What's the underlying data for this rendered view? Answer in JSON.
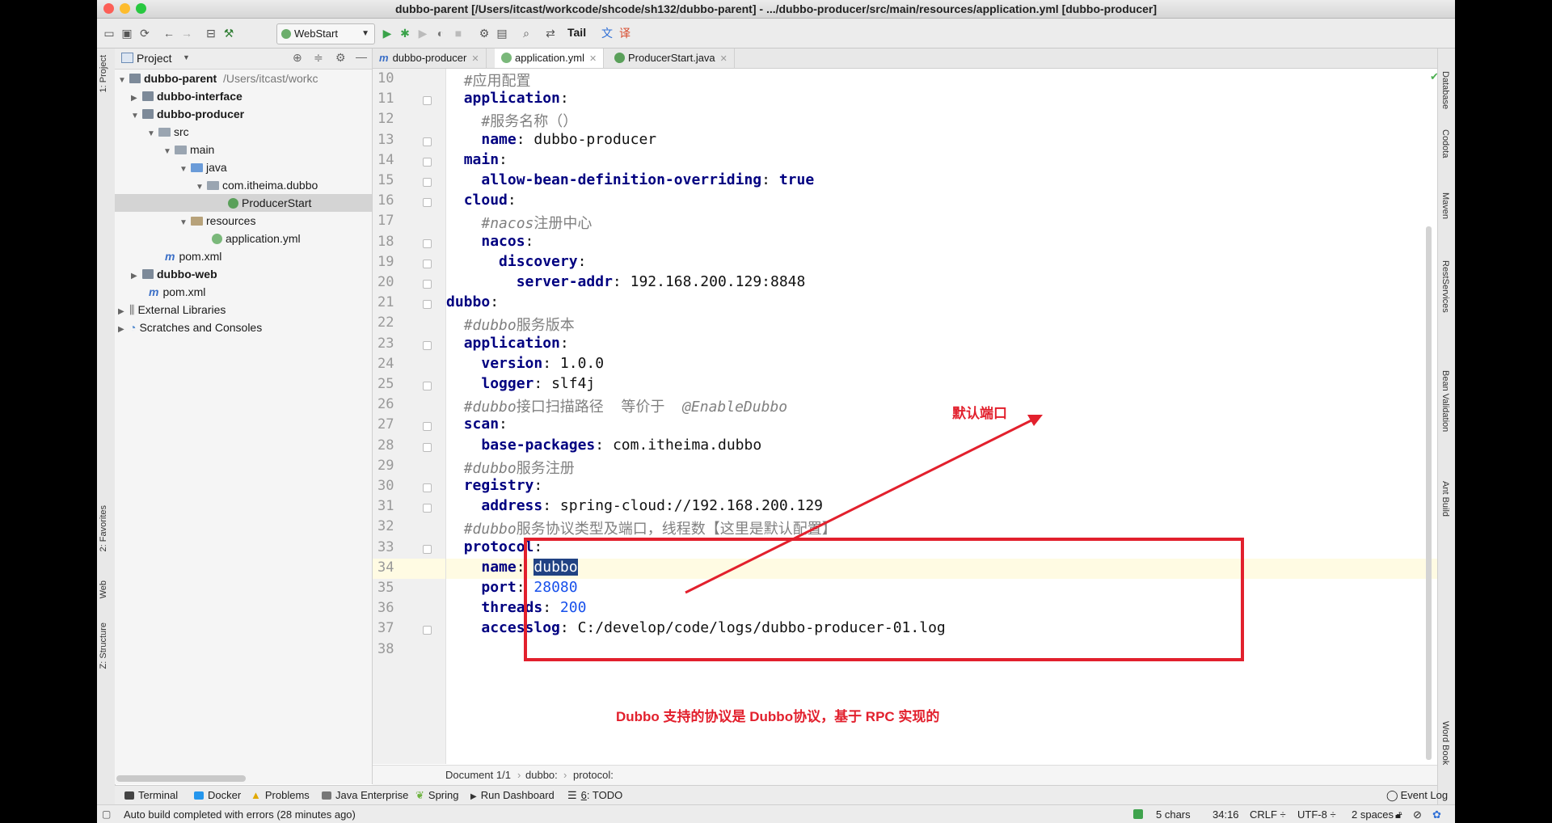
{
  "window": {
    "title": "dubbo-parent [/Users/itcast/workcode/shcode/sh132/dubbo-parent] - .../dubbo-producer/src/main/resources/application.yml [dubbo-producer]"
  },
  "toolbar": {
    "run_config": "WebStart",
    "tail_label": "Tail",
    "icons": [
      "open-folder-icon",
      "save-icon",
      "sync-icon",
      "back-arrow-icon",
      "forward-arrow-icon",
      "structure-icon",
      "hammer-icon",
      "run-icon",
      "debug-icon",
      "coverage-icon",
      "profile-icon",
      "stop-icon",
      "wrench-icon",
      "search-icon",
      "project-structure-icon",
      "translate-icon",
      "translate-red-icon"
    ]
  },
  "left_stripe": {
    "project": "1: Project",
    "favorites": "2: Favorites",
    "web": "Web",
    "structure": "Z: Structure"
  },
  "project_panel": {
    "header": "Project",
    "tree": [
      {
        "label": "dubbo-parent",
        "suffix": "/Users/itcast/workc",
        "bold": true
      },
      {
        "label": "dubbo-interface",
        "bold": true
      },
      {
        "label": "dubbo-producer",
        "bold": true
      },
      {
        "label": "src"
      },
      {
        "label": "main"
      },
      {
        "label": "java"
      },
      {
        "label": "com.itheima.dubbo"
      },
      {
        "label": "ProducerStart"
      },
      {
        "label": "resources"
      },
      {
        "label": "application.yml"
      },
      {
        "label": "pom.xml"
      },
      {
        "label": "dubbo-web",
        "bold": true
      },
      {
        "label": "pom.xml"
      },
      {
        "label": "External Libraries"
      },
      {
        "label": "Scratches and Consoles"
      }
    ]
  },
  "tabs": [
    {
      "label": "dubbo-producer"
    },
    {
      "label": "application.yml"
    },
    {
      "label": "ProducerStart.java"
    }
  ],
  "editor": {
    "line_numbers": [
      "10",
      "11",
      "12",
      "13",
      "14",
      "15",
      "16",
      "17",
      "18",
      "19",
      "20",
      "21",
      "22",
      "23",
      "24",
      "25",
      "26",
      "27",
      "28",
      "29",
      "30",
      "31",
      "32",
      "33",
      "34",
      "35",
      "36",
      "37",
      "38"
    ],
    "lines": [
      {
        "indent": "  ",
        "comment": "#应用配置"
      },
      {
        "indent": "  ",
        "key": "application",
        "sep": ":"
      },
      {
        "indent": "    ",
        "comment": "#服务名称（）"
      },
      {
        "indent": "    ",
        "key": "name",
        "sep": ": ",
        "value": "dubbo-producer"
      },
      {
        "indent": "  ",
        "key": "main",
        "sep": ":"
      },
      {
        "indent": "    ",
        "key": "allow-bean-definition-overriding",
        "sep": ": ",
        "value": "true"
      },
      {
        "indent": "  ",
        "key": "cloud",
        "sep": ":"
      },
      {
        "indent": "    ",
        "comment_italic": "#nacos",
        "comment": "注册中心"
      },
      {
        "indent": "    ",
        "key": "nacos",
        "sep": ":"
      },
      {
        "indent": "      ",
        "key": "discovery",
        "sep": ":"
      },
      {
        "indent": "        ",
        "key": "server-addr",
        "sep": ": ",
        "value": "192.168.200.129:8848"
      },
      {
        "indent": "",
        "key": "dubbo",
        "sep": ":"
      },
      {
        "indent": "  ",
        "comment_italic": "#dubbo",
        "comment": "服务版本"
      },
      {
        "indent": "  ",
        "key": "application",
        "sep": ":"
      },
      {
        "indent": "    ",
        "key": "version",
        "sep": ": ",
        "value": "1.0.0"
      },
      {
        "indent": "    ",
        "key": "logger",
        "sep": ": ",
        "value": "slf4j"
      },
      {
        "indent": "  ",
        "comment_italic": "#dubbo",
        "comment": "接口扫描路径  等价于  ",
        "comment_tail": "@EnableDubbo"
      },
      {
        "indent": "  ",
        "key": "scan",
        "sep": ":"
      },
      {
        "indent": "    ",
        "key": "base-packages",
        "sep": ": ",
        "value": "com.itheima.dubbo"
      },
      {
        "indent": "  ",
        "comment_italic": "#dubbo",
        "comment": "服务注册"
      },
      {
        "indent": "  ",
        "key": "registry",
        "sep": ":"
      },
      {
        "indent": "    ",
        "key": "address",
        "sep": ": ",
        "value": "spring-cloud://192.168.200.129"
      },
      {
        "indent": "  ",
        "comment_italic": "#dubbo",
        "comment": "服务协议类型及端口，线程数【这里是默认配置】"
      },
      {
        "indent": "  ",
        "key": "protocol",
        "sep": ":"
      },
      {
        "indent": "    ",
        "key": "name",
        "sep": ": ",
        "value": "dubbo"
      },
      {
        "indent": "    ",
        "key": "port",
        "sep": ": ",
        "value": "28080"
      },
      {
        "indent": "    ",
        "key": "threads",
        "sep": ": ",
        "value": "200"
      },
      {
        "indent": "    ",
        "key": "accesslog",
        "sep": ": ",
        "value": "C:/develop/code/logs/dubbo-producer-01.log"
      },
      {
        "indent": ""
      }
    ],
    "current_line": "34"
  },
  "annotations": {
    "default_port": "默认端口",
    "dubbo_protocol_note": "Dubbo 支持的协议是 Dubbo协议，基于 RPC 实现的",
    "accent_color": "#e2202d"
  },
  "breadcrumb": {
    "doc": "Document 1/1",
    "crumb1": "dubbo:",
    "crumb2": "protocol:"
  },
  "right_stripe": [
    "Database",
    "Codota",
    "Maven",
    "RestServices",
    "Bean Validation",
    "Ant Build",
    "Word Book"
  ],
  "bottom_tools": {
    "terminal": "Terminal",
    "docker": "Docker",
    "problems": "Problems",
    "java_enterprise": "Java Enterprise",
    "spring": "Spring",
    "run_dashboard": "Run Dashboard",
    "todo_num": "6",
    "todo": ": TODO",
    "event_log": "Event Log"
  },
  "status": {
    "message": "Auto build completed with errors (28 minutes ago)",
    "chars": "5 chars",
    "position": "34:16",
    "line_sep": "CRLF ÷",
    "encoding": "UTF-8 ÷",
    "indent": "2 spaces ÷"
  }
}
